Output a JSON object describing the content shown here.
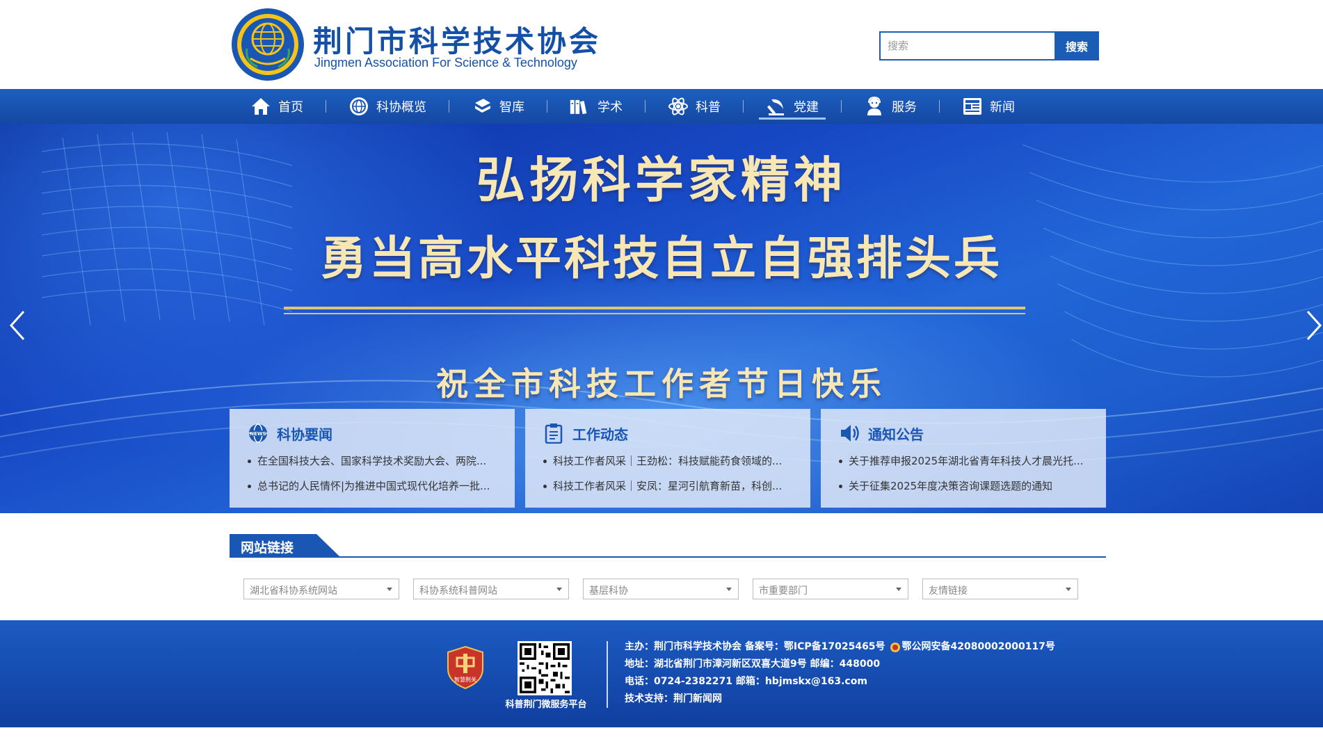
{
  "header": {
    "title": "荆门市科学技术协会",
    "subtitle": "Jingmen Association For Science & Technology",
    "search": {
      "placeholder": "搜索",
      "button": "搜索"
    }
  },
  "nav": {
    "items": [
      {
        "label": "首页",
        "icon": "home-icon"
      },
      {
        "label": "科协概览",
        "icon": "globe-emblem-icon"
      },
      {
        "label": "智库",
        "icon": "book-icon"
      },
      {
        "label": "学术",
        "icon": "books-shelf-icon"
      },
      {
        "label": "科普",
        "icon": "atom-icon"
      },
      {
        "label": "党建",
        "icon": "hammer-sickle-icon"
      },
      {
        "label": "服务",
        "icon": "service-person-icon"
      },
      {
        "label": "新闻",
        "icon": "newspaper-icon"
      }
    ],
    "active_index": 5
  },
  "banner": {
    "line1": "弘扬科学家精神",
    "line2": "勇当高水平科技自立自强排头兵",
    "line3": "祝全市科技工作者节日快乐"
  },
  "cards": [
    {
      "title": "科协要闻",
      "icon": "news-globe-icon",
      "items": [
        "在全国科技大会、国家科学技术奖励大会、两院...",
        "总书记的人民情怀|为推进中国式现代化培养一批..."
      ]
    },
    {
      "title": "工作动态",
      "icon": "clipboard-icon",
      "items": [
        "科技工作者风采｜王劲松：科技赋能药食领域的...",
        "科技工作者风采｜安凤：星河引航育新苗，科创..."
      ]
    },
    {
      "title": "通知公告",
      "icon": "speaker-icon",
      "items": [
        "关于推荐申报2025年湖北省青年科技人才晨光托...",
        "关于征集2025年度决策咨询课题选题的通知"
      ]
    }
  ],
  "links": {
    "title": "网站链接",
    "selects": [
      "湖北省科协系统网站",
      "科协系统科普网站",
      "基层科协",
      "市重要部门",
      "友情链接"
    ]
  },
  "footer": {
    "qr_caption": "科普荆门微服务平台",
    "badge_text": "智慧荆关",
    "row1": "主办：荆门市科学技术协会 备案号：鄂ICP备17025465号",
    "row1_police": "鄂公网安备42080002000117号",
    "row2": "地址：湖北省荆门市漳河新区双喜大道9号 邮编：448000",
    "row3": "电话：0724-2382271 邮箱：hbjmskx@163.com",
    "row4": "技术支持：荆门新闻网"
  },
  "colors": {
    "primary": "#1a56b4",
    "nav_bg": "#1d5fbe",
    "banner_text": "#f7e7b4",
    "gold_rule": "#e2c66f"
  }
}
